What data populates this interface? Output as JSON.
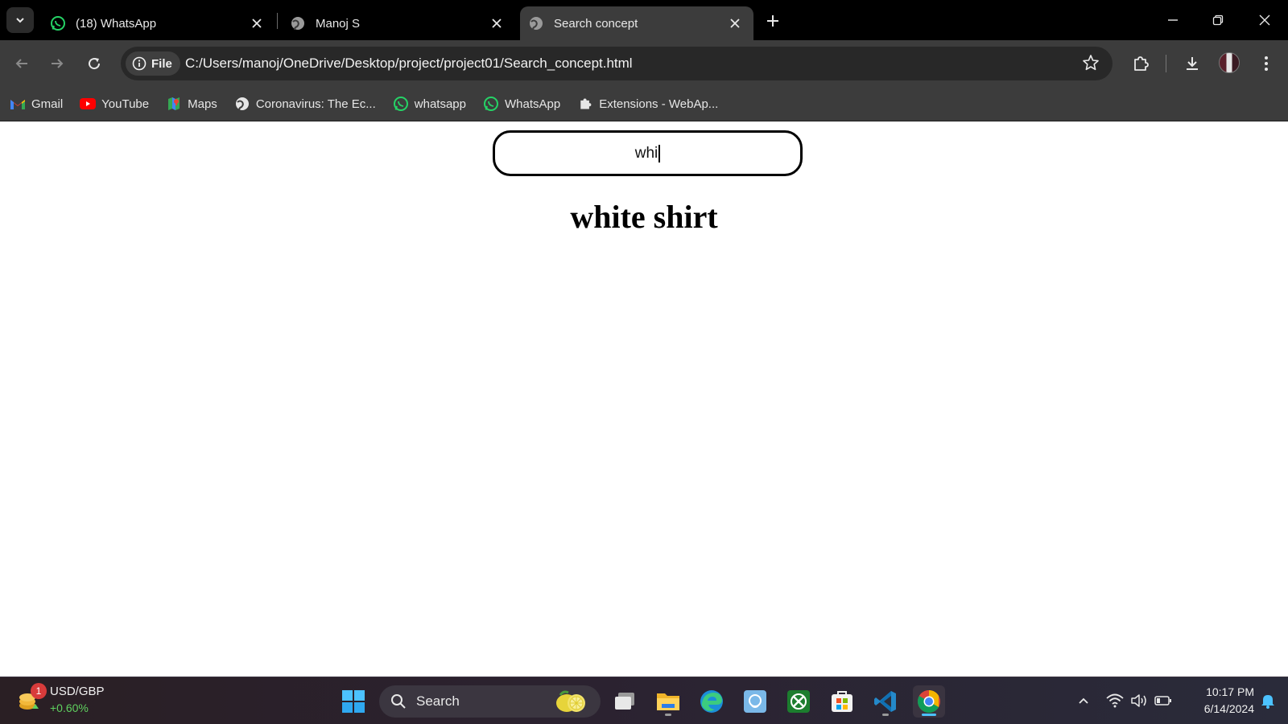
{
  "browser": {
    "tabs": [
      {
        "title": "(18) WhatsApp",
        "icon": "whatsapp-icon",
        "active": false
      },
      {
        "title": "Manoj S",
        "icon": "globe-icon",
        "active": false
      },
      {
        "title": "Search concept",
        "icon": "globe-icon",
        "active": true
      }
    ],
    "site_chip": "File",
    "url": "C:/Users/manoj/OneDrive/Desktop/project/project01/Search_concept.html",
    "bookmarks": [
      {
        "label": "Gmail",
        "icon": "gmail-icon"
      },
      {
        "label": "YouTube",
        "icon": "youtube-icon"
      },
      {
        "label": "Maps",
        "icon": "maps-icon"
      },
      {
        "label": "Coronavirus: The Ec...",
        "icon": "globe-icon"
      },
      {
        "label": "whatsapp",
        "icon": "whatsapp-icon"
      },
      {
        "label": "WhatsApp",
        "icon": "whatsapp-icon"
      },
      {
        "label": "Extensions - WebAp...",
        "icon": "puzzle-icon"
      }
    ]
  },
  "page": {
    "search_value": "whi",
    "result": "white shirt"
  },
  "taskbar": {
    "widget": {
      "badge": "1",
      "title": "USD/GBP",
      "change": "+0.60%"
    },
    "search_label": "Search",
    "clock": {
      "time": "10:17 PM",
      "date": "6/14/2024"
    }
  },
  "colors": {
    "tab_strip": "#000000",
    "toolbar": "#3c3c3c",
    "whatsapp_green": "#25d366",
    "chrome_active_underline": "#4cc2ff"
  }
}
